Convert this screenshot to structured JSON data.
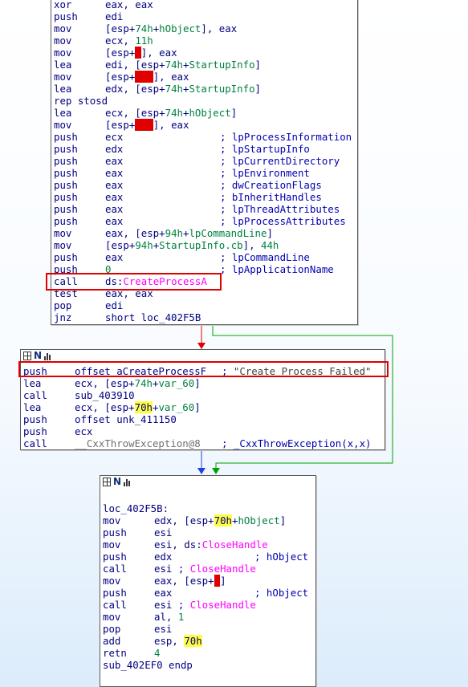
{
  "colors": {
    "red_edge": "#e00000",
    "green_edge": "#00a000",
    "blue_edge": "#2040e0",
    "highlight_yellow": "#ffff40",
    "highlight_red": "#e00000"
  },
  "icons": [
    "graph-icon",
    "n-icon",
    "bars-icon"
  ],
  "block1": {
    "lines": [
      {
        "mn": "xor",
        "ops": [
          {
            "t": "eax, eax"
          }
        ]
      },
      {
        "mn": "push",
        "ops": [
          {
            "t": "edi"
          }
        ]
      },
      {
        "mn": "mov",
        "ops": [
          {
            "t": "[esp+"
          },
          {
            "t": "74h",
            "c": "imm"
          },
          {
            "t": "+"
          },
          {
            "t": "hObject",
            "c": "imm"
          },
          {
            "t": "], eax"
          }
        ]
      },
      {
        "mn": "mov",
        "ops": [
          {
            "t": "ecx, "
          },
          {
            "t": "11h",
            "c": "imm"
          }
        ]
      },
      {
        "mn": "mov",
        "ops": [
          {
            "t": "[esp+"
          },
          {
            "t": "8",
            "c": "hl-red"
          },
          {
            "t": "], eax"
          }
        ]
      },
      {
        "mn": "lea",
        "ops": [
          {
            "t": "edi, [esp+"
          },
          {
            "t": "74h",
            "c": "imm"
          },
          {
            "t": "+"
          },
          {
            "t": "StartupInfo",
            "c": "imm"
          },
          {
            "t": "]"
          }
        ]
      },
      {
        "mn": "mov",
        "ops": [
          {
            "t": "[esp+"
          },
          {
            "t": "0Ch",
            "c": "hl-red"
          },
          {
            "t": "], eax"
          }
        ]
      },
      {
        "mn": "lea",
        "ops": [
          {
            "t": "edx, [esp+"
          },
          {
            "t": "74h",
            "c": "imm"
          },
          {
            "t": "+"
          },
          {
            "t": "StartupInfo",
            "c": "imm"
          },
          {
            "t": "]"
          }
        ]
      },
      {
        "mn": "rep stosd",
        "ops": []
      },
      {
        "mn": "lea",
        "ops": [
          {
            "t": "ecx, [esp+"
          },
          {
            "t": "74h",
            "c": "imm"
          },
          {
            "t": "+"
          },
          {
            "t": "hObject",
            "c": "imm"
          },
          {
            "t": "]"
          }
        ]
      },
      {
        "mn": "mov",
        "ops": [
          {
            "t": "[esp+"
          },
          {
            "t": "10h",
            "c": "hl-red"
          },
          {
            "t": "], eax"
          }
        ]
      },
      {
        "mn": "push",
        "ops": [
          {
            "t": "ecx"
          }
        ],
        "cmt": "; lpProcessInformation"
      },
      {
        "mn": "push",
        "ops": [
          {
            "t": "edx"
          }
        ],
        "cmt": "; lpStartupInfo"
      },
      {
        "mn": "push",
        "ops": [
          {
            "t": "eax"
          }
        ],
        "cmt": "; lpCurrentDirectory"
      },
      {
        "mn": "push",
        "ops": [
          {
            "t": "eax"
          }
        ],
        "cmt": "; lpEnvironment"
      },
      {
        "mn": "push",
        "ops": [
          {
            "t": "eax"
          }
        ],
        "cmt": "; dwCreationFlags"
      },
      {
        "mn": "push",
        "ops": [
          {
            "t": "eax"
          }
        ],
        "cmt": "; bInheritHandles"
      },
      {
        "mn": "push",
        "ops": [
          {
            "t": "eax"
          }
        ],
        "cmt": "; lpThreadAttributes"
      },
      {
        "mn": "push",
        "ops": [
          {
            "t": "eax"
          }
        ],
        "cmt": "; lpProcessAttributes"
      },
      {
        "mn": "mov",
        "ops": [
          {
            "t": "eax, [esp+"
          },
          {
            "t": "94h",
            "c": "imm"
          },
          {
            "t": "+"
          },
          {
            "t": "lpCommandLine",
            "c": "imm"
          },
          {
            "t": "]"
          }
        ]
      },
      {
        "mn": "mov",
        "ops": [
          {
            "t": "[esp+"
          },
          {
            "t": "94h",
            "c": "imm"
          },
          {
            "t": "+"
          },
          {
            "t": "StartupInfo.cb",
            "c": "imm"
          },
          {
            "t": "], "
          },
          {
            "t": "44h",
            "c": "imm"
          }
        ]
      },
      {
        "mn": "push",
        "ops": [
          {
            "t": "eax"
          }
        ],
        "cmt": "; lpCommandLine"
      },
      {
        "mn": "push",
        "ops": [
          {
            "t": "0",
            "c": "imm"
          }
        ],
        "cmt": "; lpApplicationName"
      },
      {
        "mn": "call",
        "ops": [
          {
            "t": "ds:"
          },
          {
            "t": "CreateProcessA",
            "c": "api"
          }
        ]
      },
      {
        "mn": "test",
        "ops": [
          {
            "t": "eax, eax"
          }
        ]
      },
      {
        "mn": "pop",
        "ops": [
          {
            "t": "edi"
          }
        ]
      },
      {
        "mn": "jnz",
        "ops": [
          {
            "t": "short loc_402F5B"
          }
        ]
      }
    ]
  },
  "block2": {
    "lines": [
      {
        "mn": "push",
        "ops": [
          {
            "t": "offset aCreateProcessF"
          }
        ],
        "cmt": "; \"Create Process Failed\"",
        "cmt_class": "str"
      },
      {
        "mn": "lea",
        "ops": [
          {
            "t": "ecx, [esp+"
          },
          {
            "t": "74h",
            "c": "imm"
          },
          {
            "t": "+"
          },
          {
            "t": "var_60",
            "c": "imm"
          },
          {
            "t": "]"
          }
        ]
      },
      {
        "mn": "call",
        "ops": [
          {
            "t": "sub_403910"
          }
        ]
      },
      {
        "mn": "lea",
        "ops": [
          {
            "t": "ecx, [esp+"
          },
          {
            "t": "70h",
            "c": "hl-yel"
          },
          {
            "t": "+"
          },
          {
            "t": "var_60",
            "c": "imm"
          },
          {
            "t": "]"
          }
        ]
      },
      {
        "mn": "push",
        "ops": [
          {
            "t": "offset unk_411150"
          }
        ]
      },
      {
        "mn": "push",
        "ops": [
          {
            "t": "ecx"
          }
        ]
      },
      {
        "mn": "call",
        "ops": [
          {
            "t": "__CxxThrowException@8",
            "c": "dim"
          }
        ],
        "cmt": "; _CxxThrowException(x,x)"
      }
    ]
  },
  "block3": {
    "lines": [
      {
        "mn": "",
        "ops": []
      },
      {
        "mn": "loc_402F5B:",
        "ops": []
      },
      {
        "mn": "mov",
        "ops": [
          {
            "t": "edx, [esp+"
          },
          {
            "t": "70h",
            "c": "hl-yel"
          },
          {
            "t": "+"
          },
          {
            "t": "hObject",
            "c": "imm"
          },
          {
            "t": "]"
          }
        ]
      },
      {
        "mn": "push",
        "ops": [
          {
            "t": "esi"
          }
        ]
      },
      {
        "mn": "mov",
        "ops": [
          {
            "t": "esi, ds:"
          },
          {
            "t": "CloseHandle",
            "c": "api"
          }
        ]
      },
      {
        "mn": "push",
        "ops": [
          {
            "t": "edx"
          }
        ],
        "cmt": "; hObject"
      },
      {
        "mn": "call",
        "ops": [
          {
            "t": "esi "
          },
          {
            "t": "; ",
            "c": "cmt"
          },
          {
            "t": "CloseHandle",
            "c": "api"
          }
        ]
      },
      {
        "mn": "mov",
        "ops": [
          {
            "t": "eax, [esp+"
          },
          {
            "t": "8",
            "c": "hl-red"
          },
          {
            "t": "]"
          }
        ]
      },
      {
        "mn": "push",
        "ops": [
          {
            "t": "eax"
          }
        ],
        "cmt": "; hObject"
      },
      {
        "mn": "call",
        "ops": [
          {
            "t": "esi "
          },
          {
            "t": "; ",
            "c": "cmt"
          },
          {
            "t": "CloseHandle",
            "c": "api"
          }
        ]
      },
      {
        "mn": "mov",
        "ops": [
          {
            "t": "al, "
          },
          {
            "t": "1",
            "c": "imm"
          }
        ]
      },
      {
        "mn": "pop",
        "ops": [
          {
            "t": "esi"
          }
        ]
      },
      {
        "mn": "add",
        "ops": [
          {
            "t": "esp, "
          },
          {
            "t": "70h",
            "c": "hl-yel"
          }
        ]
      },
      {
        "mn": "retn",
        "ops": [
          {
            "t": "4",
            "c": "imm"
          }
        ]
      },
      {
        "mn": "sub_402EF0 endp",
        "ops": []
      }
    ]
  }
}
